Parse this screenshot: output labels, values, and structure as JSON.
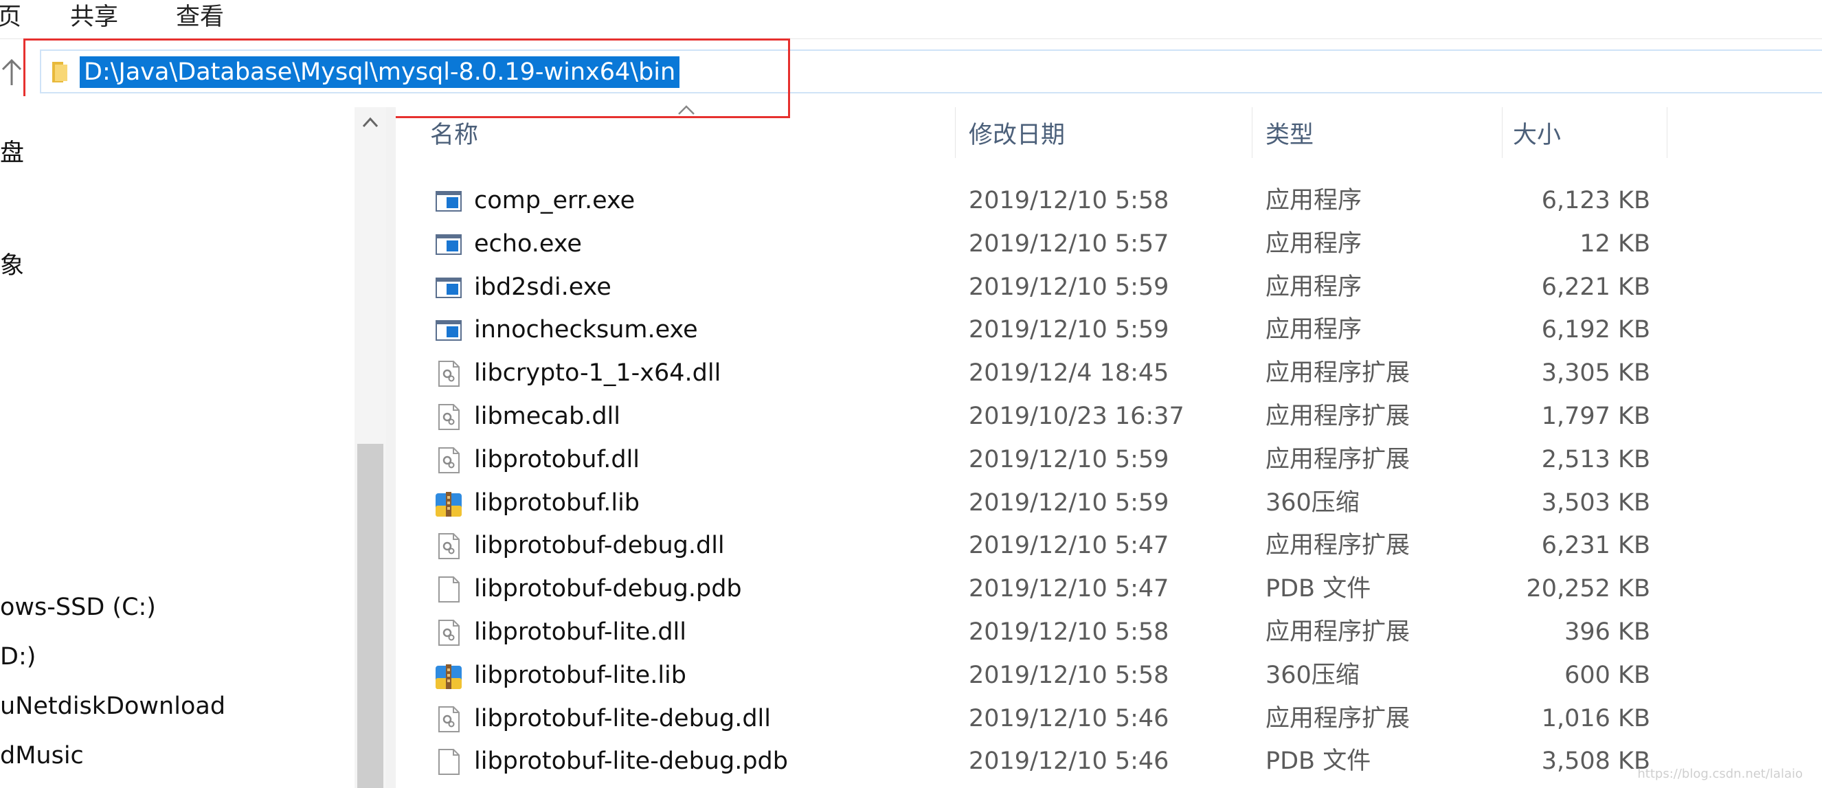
{
  "ribbon": {
    "tabs": [
      "页",
      "共享",
      "查看"
    ]
  },
  "address": {
    "path": "D:\\Java\\Database\\Mysql\\mysql-8.0.19-winx64\\bin"
  },
  "nav": {
    "items": [
      "盘",
      "象",
      "ows-SSD (C:)",
      "D:)",
      "uNetdiskDownload",
      "dMusic"
    ]
  },
  "columns": {
    "name": "名称",
    "date": "修改日期",
    "type": "类型",
    "size": "大小"
  },
  "files": [
    {
      "icon": "app-exe-icon",
      "name": "comp_err.exe",
      "date": "2019/12/10 5:58",
      "type": "应用程序",
      "size": "6,123 KB"
    },
    {
      "icon": "app-exe-icon",
      "name": "echo.exe",
      "date": "2019/12/10 5:57",
      "type": "应用程序",
      "size": "12 KB"
    },
    {
      "icon": "app-exe-icon",
      "name": "ibd2sdi.exe",
      "date": "2019/12/10 5:59",
      "type": "应用程序",
      "size": "6,221 KB"
    },
    {
      "icon": "app-exe-icon",
      "name": "innochecksum.exe",
      "date": "2019/12/10 5:59",
      "type": "应用程序",
      "size": "6,192 KB"
    },
    {
      "icon": "dll-gear-icon",
      "name": "libcrypto-1_1-x64.dll",
      "date": "2019/12/4 18:45",
      "type": "应用程序扩展",
      "size": "3,305 KB"
    },
    {
      "icon": "dll-gear-icon",
      "name": "libmecab.dll",
      "date": "2019/10/23 16:37",
      "type": "应用程序扩展",
      "size": "1,797 KB"
    },
    {
      "icon": "dll-gear-icon",
      "name": "libprotobuf.dll",
      "date": "2019/12/10 5:59",
      "type": "应用程序扩展",
      "size": "2,513 KB"
    },
    {
      "icon": "archive-360-icon",
      "name": "libprotobuf.lib",
      "date": "2019/12/10 5:59",
      "type": "360压缩",
      "size": "3,503 KB"
    },
    {
      "icon": "dll-gear-icon",
      "name": "libprotobuf-debug.dll",
      "date": "2019/12/10 5:47",
      "type": "应用程序扩展",
      "size": "6,231 KB"
    },
    {
      "icon": "blank-file-icon",
      "name": "libprotobuf-debug.pdb",
      "date": "2019/12/10 5:47",
      "type": "PDB 文件",
      "size": "20,252 KB"
    },
    {
      "icon": "dll-gear-icon",
      "name": "libprotobuf-lite.dll",
      "date": "2019/12/10 5:58",
      "type": "应用程序扩展",
      "size": "396 KB"
    },
    {
      "icon": "archive-360-icon",
      "name": "libprotobuf-lite.lib",
      "date": "2019/12/10 5:58",
      "type": "360压缩",
      "size": "600 KB"
    },
    {
      "icon": "dll-gear-icon",
      "name": "libprotobuf-lite-debug.dll",
      "date": "2019/12/10 5:46",
      "type": "应用程序扩展",
      "size": "1,016 KB"
    },
    {
      "icon": "blank-file-icon",
      "name": "libprotobuf-lite-debug.pdb",
      "date": "2019/12/10 5:46",
      "type": "PDB 文件",
      "size": "3,508 KB"
    }
  ],
  "watermark": "https://blog.csdn.net/lalaio"
}
